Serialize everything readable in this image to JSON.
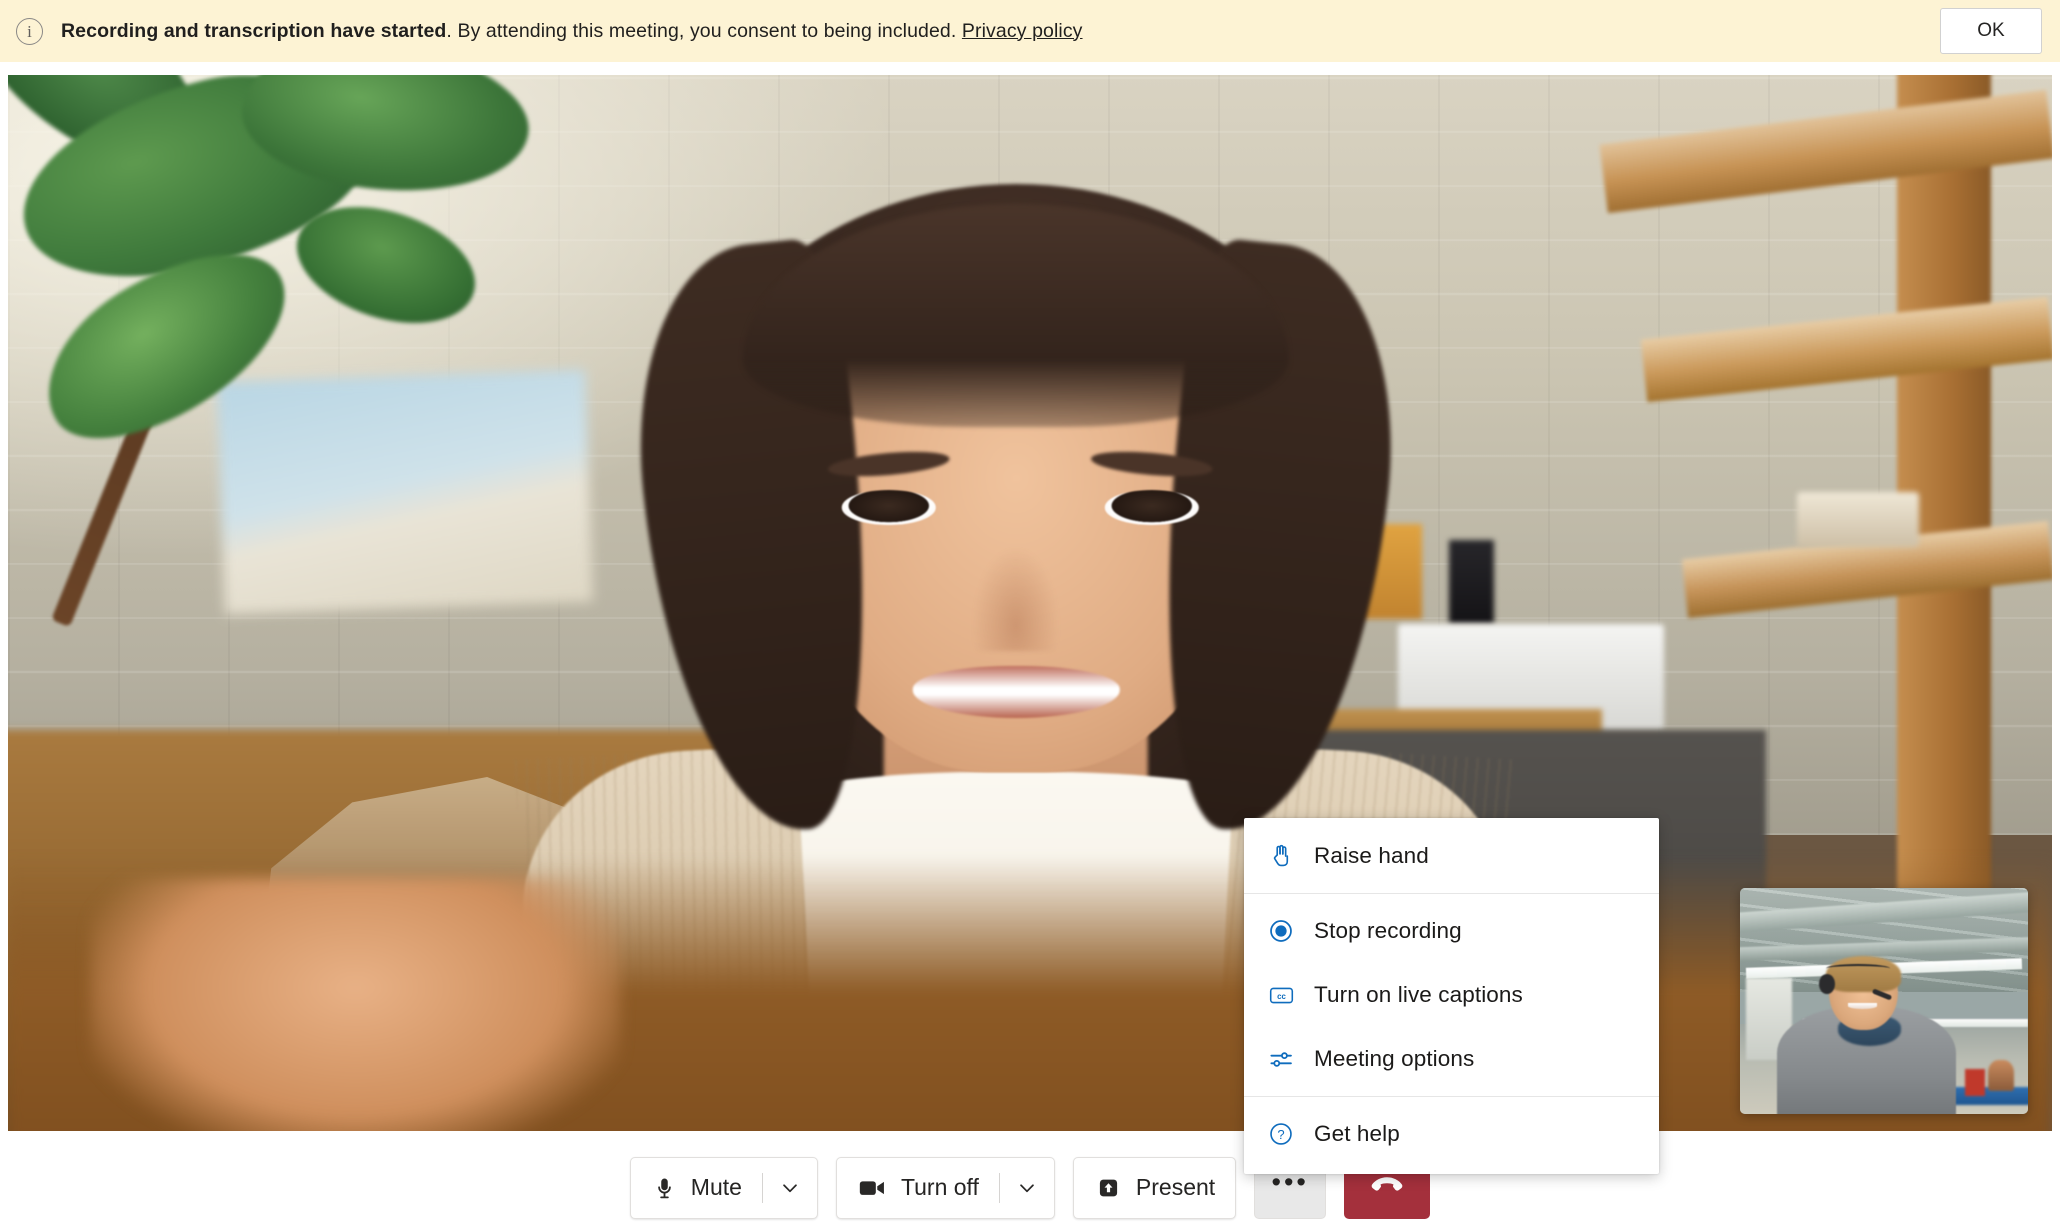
{
  "banner": {
    "icon": "info-circle-icon",
    "bold_text": "Recording and transcription have started",
    "rest_text": ". By attending this meeting, you consent to being included. ",
    "link_text": "Privacy policy",
    "ok_label": "OK",
    "background_color": "#fdf3d4"
  },
  "menu": {
    "items": [
      {
        "label": "Raise hand",
        "icon": "raise-hand-icon",
        "separator_after": true
      },
      {
        "label": "Stop recording",
        "icon": "record-filled-icon",
        "separator_after": false
      },
      {
        "label": "Turn on live captions",
        "icon": "closed-caption-icon",
        "separator_after": false
      },
      {
        "label": "Meeting options",
        "icon": "settings-sliders-icon",
        "separator_after": true
      },
      {
        "label": "Get help",
        "icon": "question-circle-icon",
        "separator_after": false
      }
    ],
    "icon_color": "#0f6cbd"
  },
  "toolbar": {
    "mic": {
      "label": "Mute",
      "icon": "microphone-icon",
      "caret": "chevron-down-icon"
    },
    "camera": {
      "label": "Turn off",
      "icon": "video-camera-icon",
      "caret": "chevron-down-icon"
    },
    "share": {
      "label": "Present",
      "icon": "share-screen-icon"
    },
    "more": {
      "label": "•••",
      "icon": "more-options-icon"
    },
    "hangup": {
      "icon": "hang-up-icon",
      "color": "#a4303c"
    }
  },
  "video": {
    "main_participant": "main-video-tile",
    "self_view": "self-view-pip-tile"
  }
}
